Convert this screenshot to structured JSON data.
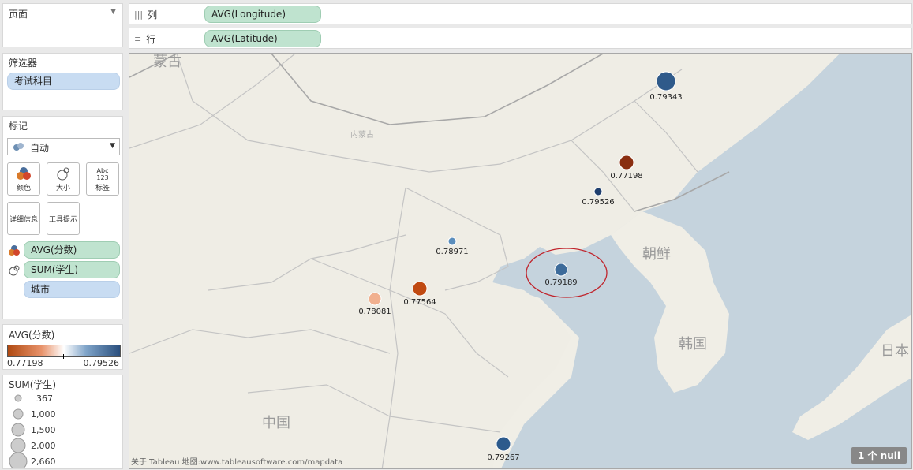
{
  "pages": {
    "title": "页面"
  },
  "columns_shelf": {
    "label": "列",
    "pill": "AVG(Longitude)"
  },
  "rows_shelf": {
    "label": "行",
    "pill": "AVG(Latitude)"
  },
  "filters": {
    "title": "筛选器",
    "items": [
      "考试科目"
    ]
  },
  "marks": {
    "title": "标记",
    "mark_type": "自动",
    "buttons": [
      "颜色",
      "大小",
      "标签",
      "详细信息",
      "工具提示"
    ],
    "label_btn_icon": "Abc\n123",
    "fields": [
      "AVG(分数)",
      "SUM(学生)",
      "城市"
    ]
  },
  "color_legend": {
    "title": "AVG(分数)",
    "min_label": "0.77198",
    "max_label": "0.79526",
    "colors": [
      "#b04a12",
      "#e8926a",
      "#ffffff",
      "#7ea3c8",
      "#2a4f7e"
    ]
  },
  "size_legend": {
    "title": "SUM(学生)",
    "items": [
      "367",
      "1,000",
      "1,500",
      "2,000",
      "2,660"
    ]
  },
  "map": {
    "place_labels": [
      "蒙古",
      "内蒙古",
      "朝鲜",
      "韩国",
      "日本",
      "中国"
    ],
    "attribution": "关于 Tableau 地图:www.tableausoftware.com/mapdata",
    "null_badge": "1 个 null",
    "points": [
      {
        "label": "0.79343",
        "value": 0.79343,
        "color": "#2f5a8a"
      },
      {
        "label": "0.77198",
        "value": 0.77198,
        "color": "#8a2e10"
      },
      {
        "label": "0.79526",
        "value": 0.79526,
        "color": "#1f3f6e"
      },
      {
        "label": "0.78971",
        "value": 0.78971,
        "color": "#5b8ebd"
      },
      {
        "label": "0.79189",
        "value": 0.79189,
        "color": "#3d6b9a"
      },
      {
        "label": "0.77564",
        "value": 0.77564,
        "color": "#c04a12"
      },
      {
        "label": "0.78081",
        "value": 0.78081,
        "color": "#f1b08f"
      },
      {
        "label": "0.79267",
        "value": 0.79267,
        "color": "#2c5a8c"
      }
    ]
  },
  "colors": {
    "pill_blue": "#c8dcf2",
    "pill_green": "#bfe3cf",
    "highlight": "#c0242c"
  }
}
